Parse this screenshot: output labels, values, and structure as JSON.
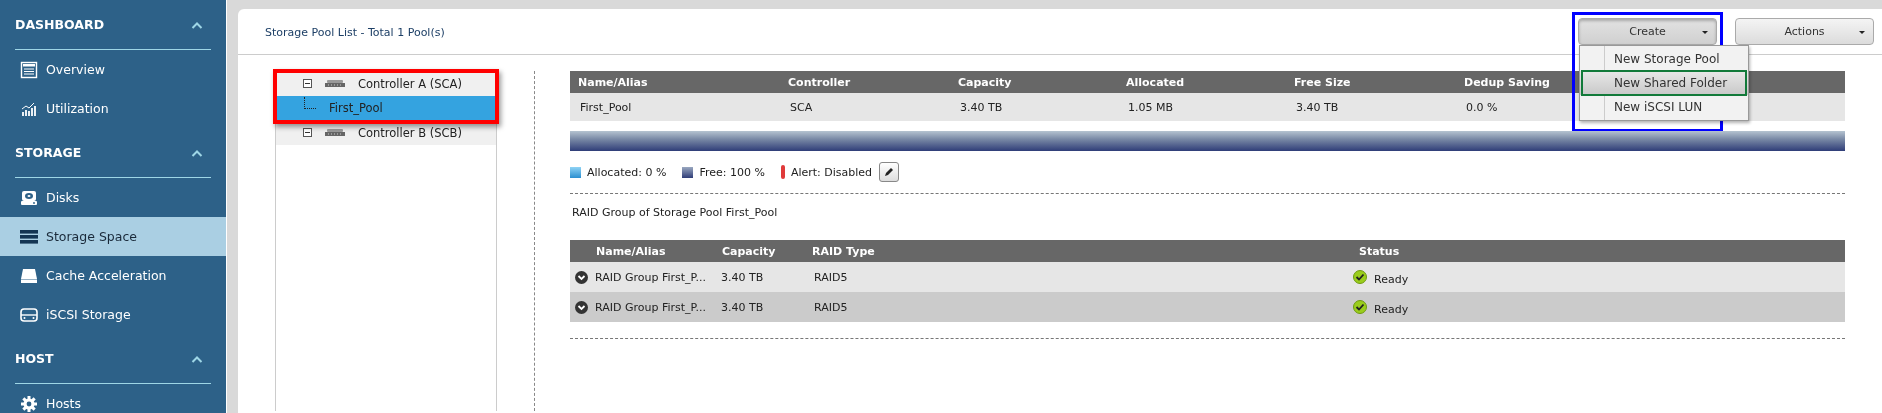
{
  "sidebar": {
    "sections": [
      {
        "title": "DASHBOARD",
        "expanded": true,
        "items": [
          {
            "label": "Overview",
            "selected": false
          },
          {
            "label": "Utilization",
            "selected": false
          }
        ]
      },
      {
        "title": "STORAGE",
        "expanded": true,
        "items": [
          {
            "label": "Disks",
            "selected": false
          },
          {
            "label": "Storage Space",
            "selected": true
          },
          {
            "label": "Cache Acceleration",
            "selected": false
          },
          {
            "label": "iSCSI Storage",
            "selected": false
          }
        ]
      },
      {
        "title": "HOST",
        "expanded": true,
        "items": [
          {
            "label": "Hosts",
            "selected": false
          }
        ]
      }
    ]
  },
  "header": {
    "title": "Storage Pool List - Total 1 Pool(s)",
    "create": {
      "label": "Create",
      "open": true,
      "menu": [
        {
          "label": "New Storage Pool",
          "selected": false
        },
        {
          "label": "New Shared Folder",
          "selected": true
        },
        {
          "label": "New iSCSI LUN",
          "selected": false
        }
      ]
    },
    "actions": {
      "label": "Actions"
    }
  },
  "tree": [
    {
      "label": "Controller A (SCA)",
      "expanded": true,
      "selected": false,
      "children": [
        {
          "label": "First_Pool",
          "selected": true
        }
      ]
    },
    {
      "label": "Controller B (SCB)",
      "expanded": true,
      "selected": false
    }
  ],
  "pool_table": {
    "columns": [
      "Name/Alias",
      "Controller",
      "Capacity",
      "Allocated",
      "Free Size",
      "Dedup Saving"
    ],
    "rows": [
      [
        "First_Pool",
        "SCA",
        "3.40 TB",
        "1.05 MB",
        "3.40 TB",
        "0.0 %"
      ]
    ]
  },
  "usage": {
    "level": 0
  },
  "legend": [
    {
      "label": "Allocated: 0 %"
    },
    {
      "label": "Free: 100 %"
    },
    {
      "label": "Alert: Disabled"
    }
  ],
  "raid": {
    "title": "RAID Group of Storage Pool First_Pool",
    "columns": [
      "Name/Alias",
      "Capacity",
      "RAID Type",
      "Status"
    ],
    "rows": [
      {
        "name": "RAID Group First_P...",
        "capacity": "3.40 TB",
        "raid_type": "RAID5",
        "status": "Ready",
        "expanded": false
      },
      {
        "name": "RAID Group First_P...",
        "capacity": "3.40 TB",
        "raid_type": "RAID5",
        "status": "Ready",
        "expanded": false
      }
    ]
  },
  "annotation_frames": [
    {
      "kind": "tree",
      "color": "#ff0000"
    },
    {
      "kind": "menu",
      "color": "#0000ff"
    },
    {
      "kind": "menu_item",
      "color": "#127a3a"
    }
  ]
}
